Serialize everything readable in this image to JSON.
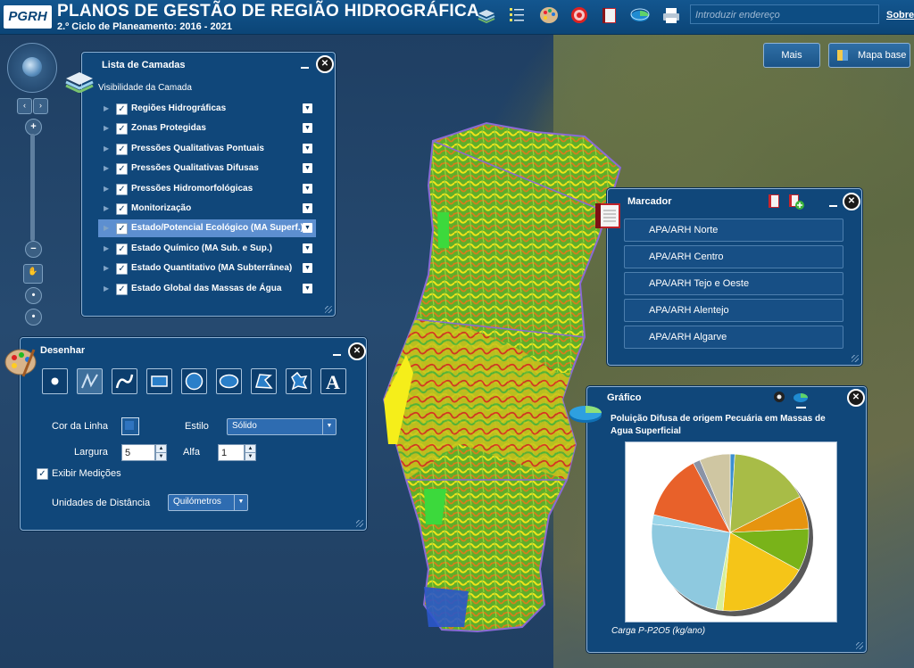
{
  "header": {
    "logo_text": "PGRH",
    "title": "PLANOS DE GESTÃO DE REGIÃO HIDROGRÁFICA",
    "subtitle": "2.º Ciclo de Planeamento: 2016 - 2021",
    "address_placeholder": "Introduzir endereço",
    "about_label": "Sobre",
    "toolbar_icons": [
      "layers-icon",
      "list-icon",
      "palette-icon",
      "target-icon",
      "bookmark-book-icon",
      "chart-icon",
      "print-icon"
    ]
  },
  "map_buttons": {
    "more_label": "Mais",
    "basemap_label": "Mapa base"
  },
  "layers_panel": {
    "title": "Lista de Camadas",
    "visibility_label": "Visibilidade da Camada",
    "layers": [
      {
        "label": "Regiões Hidrográficas",
        "checked": true
      },
      {
        "label": "Zonas Protegidas",
        "checked": true
      },
      {
        "label": "Pressões Qualitativas Pontuais",
        "checked": true
      },
      {
        "label": "Pressões Qualitativas Difusas",
        "checked": true
      },
      {
        "label": "Pressões Hidromorfológicas",
        "checked": true
      },
      {
        "label": "Monitorização",
        "checked": true
      },
      {
        "label": "Estado/Potencial Ecológico (MA Superf.)",
        "checked": true,
        "selected": true
      },
      {
        "label": "Estado Químico (MA Sub. e Sup.)",
        "checked": true
      },
      {
        "label": "Estado Quantitativo (MA Subterrânea)",
        "checked": true
      },
      {
        "label": "Estado Global das Massas de Água",
        "checked": true
      }
    ]
  },
  "draw_panel": {
    "title": "Desenhar",
    "tools": [
      "point-tool-icon",
      "freehand-line-tool-icon",
      "curve-tool-icon",
      "rectangle-tool-icon",
      "circle-tool-icon",
      "ellipse-tool-icon",
      "freehand-polygon-tool-icon",
      "polygon-tool-icon",
      "text-tool-icon"
    ],
    "line_color_label": "Cor da Linha",
    "line_color": "#2f74c0",
    "style_label": "Estilo",
    "style_value": "Sólido",
    "width_label": "Largura",
    "width_value": "5",
    "alpha_label": "Alfa",
    "alpha_value": "1",
    "show_measurements_label": "Exibir Medições",
    "show_measurements": true,
    "distance_units_label": "Unidades de Distância",
    "distance_units_value": "Quilómetros"
  },
  "bookmark_panel": {
    "title": "Marcador",
    "items": [
      "APA/ARH Norte",
      "APA/ARH Centro",
      "APA/ARH Tejo e Oeste",
      "APA/ARH Alentejo",
      "APA/ARH Algarve"
    ]
  },
  "chart_panel": {
    "title": "Gráfico",
    "chart_title": "Poluição Difusa de origem Pecuária em Massas de Agua Superficial",
    "caption": "Carga P-P2O5 (kg/ano)"
  },
  "chart_data": {
    "type": "pie",
    "title": "Poluição Difusa de origem Pecuária em Massas de Agua Superficial",
    "slices": [
      {
        "value": 1.0,
        "color": "#3b8fcf"
      },
      {
        "value": 17.0,
        "color": "#a8bc47"
      },
      {
        "value": 7.0,
        "color": "#e6940f"
      },
      {
        "value": 9.0,
        "color": "#79b319"
      },
      {
        "value": 19.0,
        "color": "#f5c518"
      },
      {
        "value": 1.5,
        "color": "#d8ef9a"
      },
      {
        "value": 24.5,
        "color": "#8ec9df"
      },
      {
        "value": 2.0,
        "color": "#9bd6ea"
      },
      {
        "value": 14.0,
        "color": "#e8612a"
      },
      {
        "value": 1.5,
        "color": "#8a93a6"
      },
      {
        "value": 6.5,
        "color": "#cfc6a2"
      }
    ]
  }
}
